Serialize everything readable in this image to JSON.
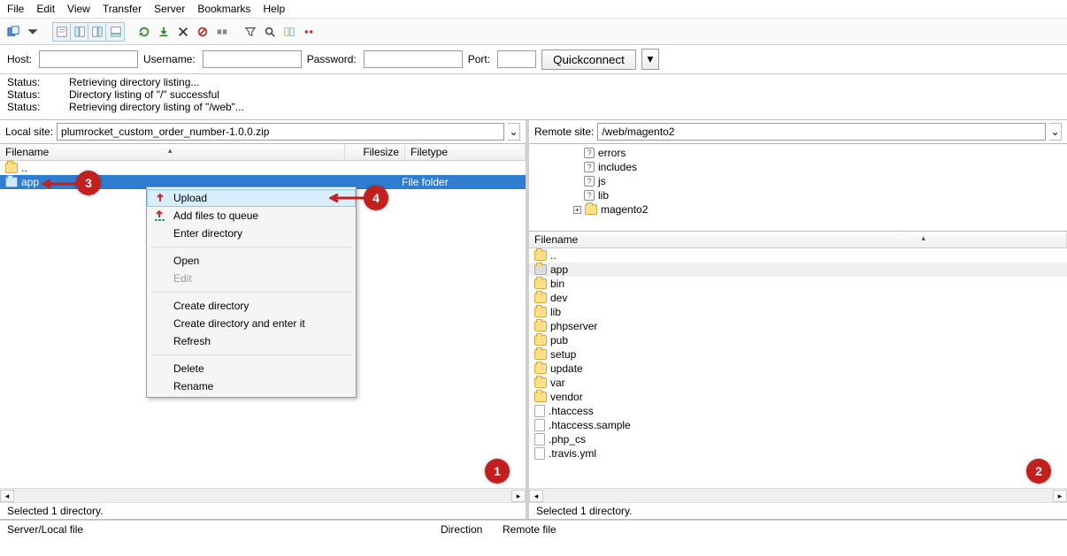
{
  "menu": [
    "File",
    "Edit",
    "View",
    "Transfer",
    "Server",
    "Bookmarks",
    "Help"
  ],
  "quick": {
    "host_label": "Host:",
    "user_label": "Username:",
    "pass_label": "Password:",
    "port_label": "Port:",
    "btn": "Quickconnect"
  },
  "log": [
    {
      "label": "Status:",
      "msg": "Retrieving directory listing..."
    },
    {
      "label": "Status:",
      "msg": "Directory listing of \"/\" successful"
    },
    {
      "label": "Status:",
      "msg": "Retrieving directory listing of \"/web\"..."
    }
  ],
  "local": {
    "label": "Local site:",
    "path": "plumrocket_custom_order_number-1.0.0.zip",
    "cols": {
      "name": "Filename",
      "size": "Filesize",
      "type": "Filetype"
    },
    "rows": [
      {
        "name": "..",
        "type": "",
        "up": true
      },
      {
        "name": "app",
        "type": "File folder",
        "sel": true
      }
    ],
    "status": "Selected 1 directory."
  },
  "remote": {
    "label": "Remote site:",
    "path": "/web/magento2",
    "tree": [
      "errors",
      "includes",
      "js",
      "lib",
      "magento2"
    ],
    "cols": {
      "name": "Filename"
    },
    "rows": [
      {
        "name": "..",
        "up": true
      },
      {
        "name": "app",
        "sel": true
      },
      {
        "name": "bin"
      },
      {
        "name": "dev"
      },
      {
        "name": "lib"
      },
      {
        "name": "phpserver"
      },
      {
        "name": "pub"
      },
      {
        "name": "setup"
      },
      {
        "name": "update"
      },
      {
        "name": "var"
      },
      {
        "name": "vendor"
      },
      {
        "name": ".htaccess",
        "file": true
      },
      {
        "name": ".htaccess.sample",
        "file": true
      },
      {
        "name": ".php_cs",
        "file": true
      },
      {
        "name": ".travis.yml",
        "file": true
      }
    ],
    "status": "Selected 1 directory."
  },
  "ctx": {
    "upload": "Upload",
    "addq": "Add files to queue",
    "enter": "Enter directory",
    "open": "Open",
    "edit": "Edit",
    "created": "Create directory",
    "createde": "Create directory and enter it",
    "refresh": "Refresh",
    "delete": "Delete",
    "rename": "Rename"
  },
  "bottom": {
    "col1": "Server/Local file",
    "col2": "Direction",
    "col3": "Remote file"
  },
  "callouts": {
    "c1": "1",
    "c2": "2",
    "c3": "3",
    "c4": "4"
  }
}
